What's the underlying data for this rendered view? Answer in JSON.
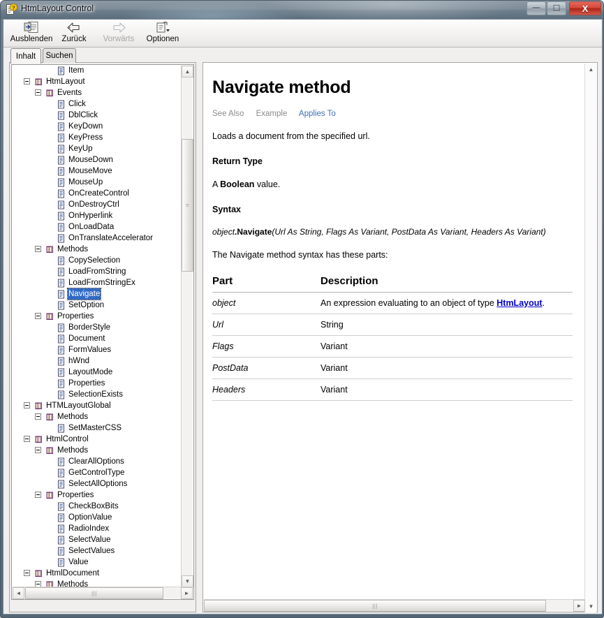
{
  "window": {
    "title": "HtmLayout Control",
    "icon": "help-document-icon",
    "buttons": {
      "minimize": "minimize-icon",
      "maximize": "maximize-icon",
      "close": "X"
    },
    "accent_close": "#c0392b"
  },
  "toolbar": {
    "items": [
      {
        "label": "Ausblenden",
        "icon": "hide-pane-icon",
        "disabled": false
      },
      {
        "label": "Zurück",
        "icon": "back-arrow-icon",
        "disabled": false
      },
      {
        "label": "Vorwärts",
        "icon": "forward-arrow-icon",
        "disabled": true
      },
      {
        "label": "Optionen",
        "icon": "options-icon",
        "disabled": false
      }
    ]
  },
  "tabs": [
    {
      "label": "Inhalt",
      "accesskey": "I",
      "selected": true
    },
    {
      "label": "Suchen",
      "accesskey": "S",
      "selected": false
    }
  ],
  "tree": {
    "selected": "Navigate",
    "nodes": [
      {
        "label": "Item",
        "depth": 4,
        "type": "page",
        "expander": false
      },
      {
        "label": "HtmLayout",
        "depth": 2,
        "type": "folder",
        "expander": true
      },
      {
        "label": "Events",
        "depth": 3,
        "type": "folder",
        "expander": true
      },
      {
        "label": "Click",
        "depth": 4,
        "type": "page",
        "expander": false
      },
      {
        "label": "DblClick",
        "depth": 4,
        "type": "page",
        "expander": false
      },
      {
        "label": "KeyDown",
        "depth": 4,
        "type": "page",
        "expander": false
      },
      {
        "label": "KeyPress",
        "depth": 4,
        "type": "page",
        "expander": false
      },
      {
        "label": "KeyUp",
        "depth": 4,
        "type": "page",
        "expander": false
      },
      {
        "label": "MouseDown",
        "depth": 4,
        "type": "page",
        "expander": false
      },
      {
        "label": "MouseMove",
        "depth": 4,
        "type": "page",
        "expander": false
      },
      {
        "label": "MouseUp",
        "depth": 4,
        "type": "page",
        "expander": false
      },
      {
        "label": "OnCreateControl",
        "depth": 4,
        "type": "page",
        "expander": false
      },
      {
        "label": "OnDestroyCtrl",
        "depth": 4,
        "type": "page",
        "expander": false
      },
      {
        "label": "OnHyperlink",
        "depth": 4,
        "type": "page",
        "expander": false
      },
      {
        "label": "OnLoadData",
        "depth": 4,
        "type": "page",
        "expander": false
      },
      {
        "label": "OnTranslateAccelerator",
        "depth": 4,
        "type": "page",
        "expander": false
      },
      {
        "label": "Methods",
        "depth": 3,
        "type": "folder",
        "expander": true
      },
      {
        "label": "CopySelection",
        "depth": 4,
        "type": "page",
        "expander": false
      },
      {
        "label": "LoadFromString",
        "depth": 4,
        "type": "page",
        "expander": false
      },
      {
        "label": "LoadFromStringEx",
        "depth": 4,
        "type": "page",
        "expander": false
      },
      {
        "label": "Navigate",
        "depth": 4,
        "type": "page",
        "expander": false,
        "selected": true
      },
      {
        "label": "SetOption",
        "depth": 4,
        "type": "page",
        "expander": false
      },
      {
        "label": "Properties",
        "depth": 3,
        "type": "folder",
        "expander": true
      },
      {
        "label": "BorderStyle",
        "depth": 4,
        "type": "page",
        "expander": false
      },
      {
        "label": "Document",
        "depth": 4,
        "type": "page",
        "expander": false
      },
      {
        "label": "FormValues",
        "depth": 4,
        "type": "page",
        "expander": false
      },
      {
        "label": "hWnd",
        "depth": 4,
        "type": "page",
        "expander": false
      },
      {
        "label": "LayoutMode",
        "depth": 4,
        "type": "page",
        "expander": false
      },
      {
        "label": "Properties",
        "depth": 4,
        "type": "page",
        "expander": false
      },
      {
        "label": "SelectionExists",
        "depth": 4,
        "type": "page",
        "expander": false
      },
      {
        "label": "HTMLayoutGlobal",
        "depth": 2,
        "type": "folder",
        "expander": true
      },
      {
        "label": "Methods",
        "depth": 3,
        "type": "folder",
        "expander": true
      },
      {
        "label": "SetMasterCSS",
        "depth": 4,
        "type": "page",
        "expander": false
      },
      {
        "label": "HtmlControl",
        "depth": 2,
        "type": "folder",
        "expander": true
      },
      {
        "label": "Methods",
        "depth": 3,
        "type": "folder",
        "expander": true
      },
      {
        "label": "ClearAllOptions",
        "depth": 4,
        "type": "page",
        "expander": false
      },
      {
        "label": "GetControlType",
        "depth": 4,
        "type": "page",
        "expander": false
      },
      {
        "label": "SelectAllOptions",
        "depth": 4,
        "type": "page",
        "expander": false
      },
      {
        "label": "Properties",
        "depth": 3,
        "type": "folder",
        "expander": true
      },
      {
        "label": "CheckBoxBits",
        "depth": 4,
        "type": "page",
        "expander": false
      },
      {
        "label": "OptionValue",
        "depth": 4,
        "type": "page",
        "expander": false
      },
      {
        "label": "RadioIndex",
        "depth": 4,
        "type": "page",
        "expander": false
      },
      {
        "label": "SelectValue",
        "depth": 4,
        "type": "page",
        "expander": false
      },
      {
        "label": "SelectValues",
        "depth": 4,
        "type": "page",
        "expander": false
      },
      {
        "label": "Value",
        "depth": 4,
        "type": "page",
        "expander": false
      },
      {
        "label": "HtmlDocument",
        "depth": 2,
        "type": "folder",
        "expander": true
      },
      {
        "label": "Methods",
        "depth": 3,
        "type": "folder",
        "expander": true
      }
    ]
  },
  "document": {
    "title": "Navigate method",
    "jumplinks": [
      {
        "label": "See Also",
        "active": false
      },
      {
        "label": "Example",
        "active": false
      },
      {
        "label": "Applies To",
        "active": true
      }
    ],
    "summary": "Loads a document from the specified url.",
    "return_type_heading": "Return Type",
    "return_type_prefix": "A ",
    "return_type_value": "Boolean",
    "return_type_suffix": " value.",
    "syntax_heading": "Syntax",
    "syntax_object": "object",
    "syntax_method": ".Navigate",
    "syntax_args": "(Url As String, Flags As Variant, PostData As Variant, Headers As Variant)",
    "parts_intro": "The Navigate method syntax has these parts:",
    "table": {
      "headers": [
        "Part",
        "Description"
      ],
      "rows": [
        {
          "part": "object",
          "desc_pre": "An expression evaluating to an object of type ",
          "desc_link": "HtmLayout",
          "desc_post": "."
        },
        {
          "part": "Url",
          "desc_pre": "String",
          "desc_link": "",
          "desc_post": ""
        },
        {
          "part": "Flags",
          "desc_pre": "Variant",
          "desc_link": "",
          "desc_post": ""
        },
        {
          "part": "PostData",
          "desc_pre": "Variant",
          "desc_link": "",
          "desc_post": ""
        },
        {
          "part": "Headers",
          "desc_pre": "Variant",
          "desc_link": "",
          "desc_post": ""
        }
      ]
    },
    "link_color": "#0000cc"
  },
  "scrollbars": {
    "up_arrow": "▲",
    "down_arrow": "▼",
    "left_arrow": "◄",
    "right_arrow": "►",
    "grip": "‖‖"
  }
}
